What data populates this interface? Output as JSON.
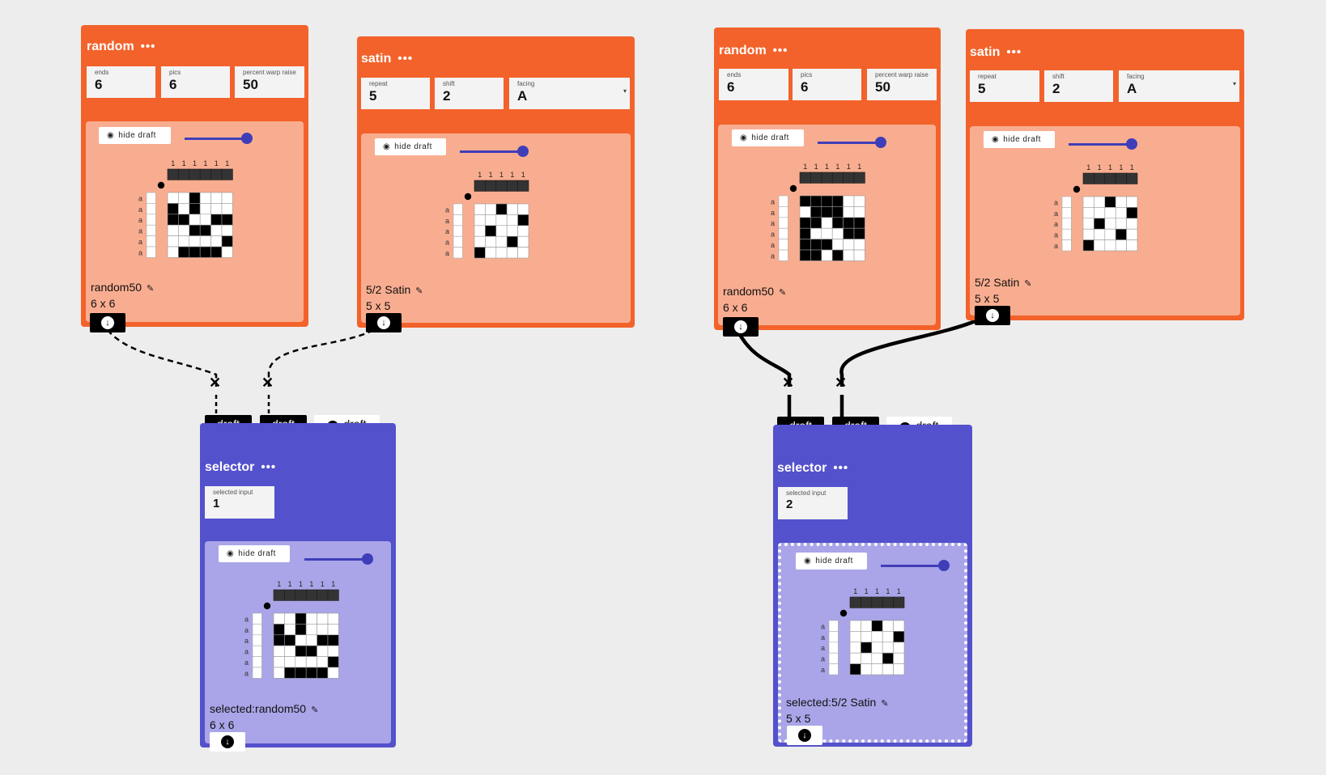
{
  "left_group": {
    "random": {
      "title": "random",
      "menu": "•••",
      "fields": [
        {
          "label": "ends",
          "value": "6"
        },
        {
          "label": "pics",
          "value": "6"
        },
        {
          "label": "percent warp raise",
          "value": "50"
        }
      ],
      "hide_label": "hide draft",
      "draft": {
        "tieups": [
          "1",
          "1",
          "1",
          "1",
          "1",
          "1"
        ],
        "rowlabels": [
          "a",
          "a",
          "a",
          "a",
          "a",
          "a"
        ],
        "grid": [
          [
            0,
            0,
            1,
            0,
            0,
            0
          ],
          [
            1,
            0,
            1,
            0,
            0,
            0
          ],
          [
            1,
            1,
            0,
            0,
            1,
            1
          ],
          [
            0,
            0,
            1,
            1,
            0,
            0
          ],
          [
            0,
            0,
            0,
            0,
            0,
            1
          ],
          [
            0,
            1,
            1,
            1,
            1,
            0
          ]
        ]
      },
      "name": "random50",
      "size": "6 x 6"
    },
    "satin": {
      "title": "satin",
      "menu": "•••",
      "fields": [
        {
          "label": "repeat",
          "value": "5"
        },
        {
          "label": "shift",
          "value": "2"
        },
        {
          "label": "facing",
          "value": "A"
        }
      ],
      "hide_label": "hide draft",
      "draft": {
        "tieups": [
          "1",
          "1",
          "1",
          "1",
          "1"
        ],
        "rowlabels": [
          "a",
          "a",
          "a",
          "a",
          "a"
        ],
        "grid": [
          [
            0,
            0,
            1,
            0,
            0
          ],
          [
            0,
            0,
            0,
            0,
            1
          ],
          [
            0,
            1,
            0,
            0,
            0
          ],
          [
            0,
            0,
            0,
            1,
            0
          ],
          [
            1,
            0,
            0,
            0,
            0
          ]
        ]
      },
      "name": "5/2 Satin",
      "size": "5 x 5"
    },
    "selector": {
      "inputs": [
        "draft",
        "draft"
      ],
      "output": "draft",
      "title": "selector",
      "menu": "•••",
      "field": {
        "label": "selected input",
        "value": "1"
      },
      "hide_label": "hide draft",
      "draft": {
        "tieups": [
          "1",
          "1",
          "1",
          "1",
          "1",
          "1"
        ],
        "rowlabels": [
          "a",
          "a",
          "a",
          "a",
          "a",
          "a"
        ],
        "grid": [
          [
            0,
            0,
            1,
            0,
            0,
            0
          ],
          [
            1,
            0,
            1,
            0,
            0,
            0
          ],
          [
            1,
            1,
            0,
            0,
            1,
            1
          ],
          [
            0,
            0,
            1,
            1,
            0,
            0
          ],
          [
            0,
            0,
            0,
            0,
            0,
            1
          ],
          [
            0,
            1,
            1,
            1,
            1,
            0
          ]
        ]
      },
      "name": "selected:random50",
      "size": "6 x 6"
    }
  },
  "right_group": {
    "random": {
      "title": "random",
      "menu": "•••",
      "fields": [
        {
          "label": "ends",
          "value": "6"
        },
        {
          "label": "pics",
          "value": "6"
        },
        {
          "label": "percent warp raise",
          "value": "50"
        }
      ],
      "hide_label": "hide draft",
      "draft": {
        "tieups": [
          "1",
          "1",
          "1",
          "1",
          "1",
          "1"
        ],
        "rowlabels": [
          "a",
          "a",
          "a",
          "a",
          "a",
          "a"
        ],
        "grid": [
          [
            1,
            1,
            1,
            1,
            0,
            0
          ],
          [
            0,
            1,
            1,
            1,
            0,
            0
          ],
          [
            1,
            1,
            0,
            1,
            1,
            1
          ],
          [
            1,
            0,
            0,
            0,
            1,
            1
          ],
          [
            1,
            1,
            1,
            0,
            0,
            0
          ],
          [
            1,
            1,
            0,
            1,
            0,
            0
          ]
        ]
      },
      "name": "random50",
      "size": "6 x 6"
    },
    "satin": {
      "title": "satin",
      "menu": "•••",
      "fields": [
        {
          "label": "repeat",
          "value": "5"
        },
        {
          "label": "shift",
          "value": "2"
        },
        {
          "label": "facing",
          "value": "A"
        }
      ],
      "hide_label": "hide draft",
      "draft": {
        "tieups": [
          "1",
          "1",
          "1",
          "1",
          "1"
        ],
        "rowlabels": [
          "a",
          "a",
          "a",
          "a",
          "a"
        ],
        "grid": [
          [
            0,
            0,
            1,
            0,
            0
          ],
          [
            0,
            0,
            0,
            0,
            1
          ],
          [
            0,
            1,
            0,
            0,
            0
          ],
          [
            0,
            0,
            0,
            1,
            0
          ],
          [
            1,
            0,
            0,
            0,
            0
          ]
        ]
      },
      "name": "5/2 Satin",
      "size": "5 x 5"
    },
    "selector": {
      "inputs": [
        "draft",
        "draft"
      ],
      "output": "draft",
      "title": "selector",
      "menu": "•••",
      "field": {
        "label": "selected input",
        "value": "2"
      },
      "hide_label": "hide draft",
      "draft": {
        "tieups": [
          "1",
          "1",
          "1",
          "1",
          "1"
        ],
        "rowlabels": [
          "a",
          "a",
          "a",
          "a",
          "a"
        ],
        "grid": [
          [
            0,
            0,
            1,
            0,
            0
          ],
          [
            0,
            0,
            0,
            0,
            1
          ],
          [
            0,
            1,
            0,
            0,
            0
          ],
          [
            0,
            0,
            0,
            1,
            0
          ],
          [
            1,
            0,
            0,
            0,
            0
          ]
        ]
      },
      "name": "selected:5/2 Satin",
      "size": "5 x 5"
    }
  },
  "icons": {
    "eye": "eye-icon",
    "edit": "edit-icon",
    "download": "download-icon",
    "remove": "close-icon",
    "menu": "more-icon"
  },
  "colors": {
    "operation": "#f3622a",
    "operation_inner": "#f9ad90",
    "selector": "#5451cc",
    "selector_inner": "#a9a5e8",
    "slider": "#3f3eb8"
  }
}
